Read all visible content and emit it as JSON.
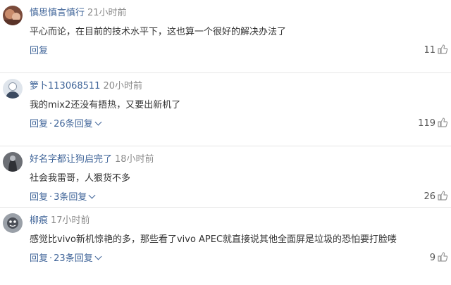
{
  "comments": [
    {
      "username": "慎思慎言慎行",
      "time": "21小时前",
      "content": "平心而论，在目前的技术水平下，这也算一个很好的解决办法了",
      "reply_label": "回复",
      "reply_count_label": "",
      "likes": "11",
      "avatar_icon": "avatar-photo-icon"
    },
    {
      "username": "箩卜113068511",
      "time": "20小时前",
      "content": "我的mix2还没有捂热，又要出新机了",
      "reply_label": "回复",
      "separator": "·",
      "reply_count_label": "26条回复",
      "likes": "119",
      "avatar_icon": "avatar-person-icon"
    },
    {
      "username": "好名字都让狗启完了",
      "time": "18小时前",
      "content": "社会我雷哥，人狠货不多",
      "reply_label": "回复",
      "separator": "·",
      "reply_count_label": "3条回复",
      "likes": "26",
      "avatar_icon": "avatar-photo-icon"
    },
    {
      "username": "柳痕",
      "time": "17小时前",
      "content": "感觉比vivo新机惊艳的多，那些看了vivo APEC就直接说其他全面屏是垃圾的恐怕要打脸喽",
      "reply_label": "回复",
      "separator": "·",
      "reply_count_label": "23条回复",
      "likes": "9",
      "avatar_icon": "avatar-photo-icon"
    }
  ],
  "colors": {
    "link": "#406599",
    "meta": "#8a8a8a",
    "text": "#333333",
    "divider": "#e6e6e6"
  },
  "icons": {
    "like": "thumbs-up-icon",
    "expand": "chevron-down-icon"
  }
}
